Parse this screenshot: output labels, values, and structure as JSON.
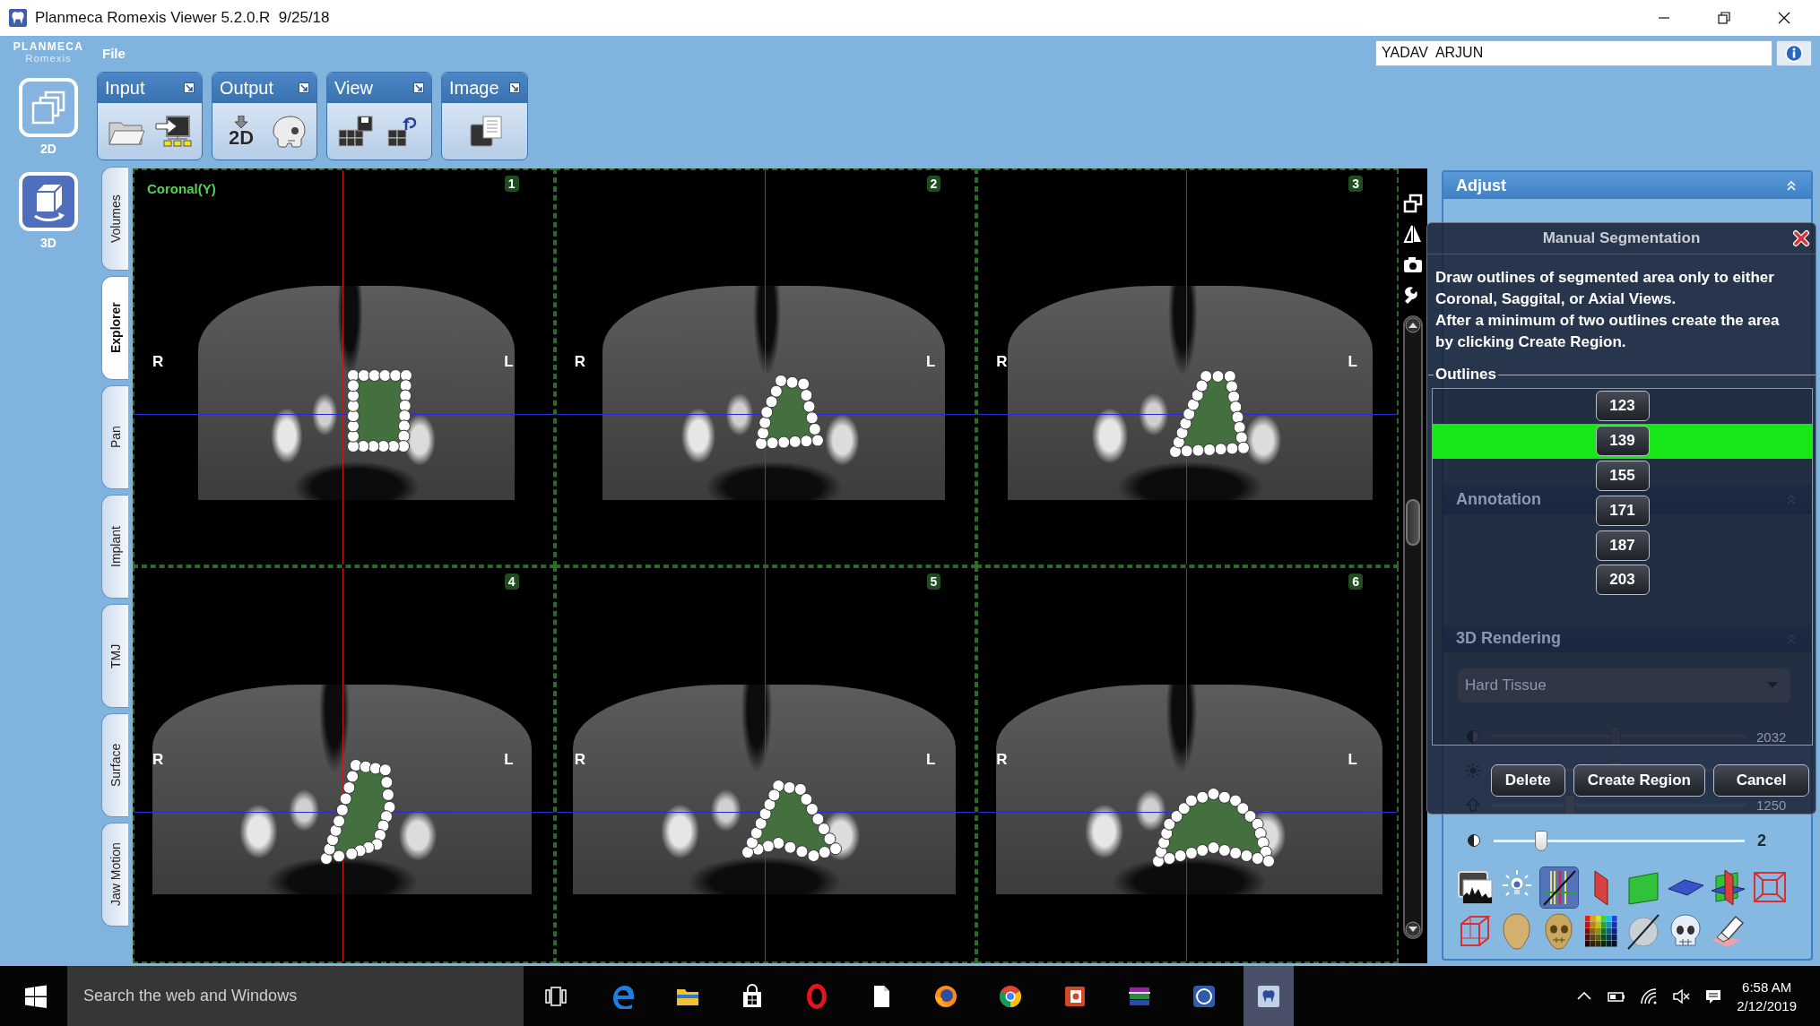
{
  "window": {
    "title": "Planmeca Romexis Viewer 5.2.0.R  9/25/18"
  },
  "logo": {
    "brand": "PLANMECA",
    "product": "Romexis"
  },
  "menu": [
    "File"
  ],
  "patient_field": {
    "value": "YADAV  ARJUN"
  },
  "modes": [
    {
      "label": "2D",
      "selected": false
    },
    {
      "label": "3D",
      "selected": true
    }
  ],
  "toolbar_groups": [
    {
      "title": "Input"
    },
    {
      "title": "Output",
      "button_text": "2D"
    },
    {
      "title": "View"
    },
    {
      "title": "Image"
    }
  ],
  "view_tabs": [
    {
      "label": "Volumes",
      "selected": false
    },
    {
      "label": "Explorer",
      "selected": true
    },
    {
      "label": "Pan",
      "selected": false
    },
    {
      "label": "Implant",
      "selected": false
    },
    {
      "label": "TMJ",
      "selected": false
    },
    {
      "label": "Surface",
      "selected": false
    },
    {
      "label": "Jaw Motion",
      "selected": false
    }
  ],
  "viewer": {
    "panels": [
      {
        "number": "1",
        "view_label": "Coronal(Y)",
        "left_marker": "R",
        "right_marker": "L"
      },
      {
        "number": "2",
        "left_marker": "R",
        "right_marker": "L"
      },
      {
        "number": "3",
        "left_marker": "R",
        "right_marker": "L"
      },
      {
        "number": "4",
        "left_marker": "R",
        "right_marker": "L"
      },
      {
        "number": "5",
        "left_marker": "R",
        "right_marker": "L"
      },
      {
        "number": "6",
        "left_marker": "R",
        "right_marker": "L"
      }
    ]
  },
  "adjust_panel": {
    "title": "Adjust",
    "annotation_section": {
      "title": "Annotation"
    },
    "rendering_section": {
      "title": "3D Rendering",
      "mode": "Hard Tissue",
      "sliders": [
        {
          "level": 0.49,
          "reading": "2032"
        },
        {
          "level": 0.49
        },
        {
          "level": 0.31,
          "reading": "1250"
        }
      ]
    },
    "point_slider": {
      "level": 0.19,
      "reading": "2"
    },
    "render_tools": [
      {
        "selected": false
      },
      {
        "selected": false
      },
      {
        "selected": true
      },
      {
        "selected": false
      },
      {
        "selected": false
      },
      {
        "selected": false
      },
      {
        "selected": false
      },
      {
        "selected": false
      },
      {
        "selected": false
      },
      {
        "selected": false
      },
      {
        "selected": false
      },
      {
        "selected": false
      },
      {
        "selected": false
      },
      {
        "selected": false
      },
      {
        "selected": false
      }
    ]
  },
  "segmentation_dialog": {
    "title": "Manual Segmentation",
    "instructions": [
      "Draw outlines of segmented area only to either Coronal, Saggital, or Axial Views.",
      "After a minimum of two outlines create the area by clicking Create Region."
    ],
    "outlines_label": "Outlines",
    "outlines": [
      {
        "label": "123",
        "selected": false
      },
      {
        "label": "139",
        "selected": true
      },
      {
        "label": "155",
        "selected": false
      },
      {
        "label": "171",
        "selected": false
      },
      {
        "label": "187",
        "selected": false
      },
      {
        "label": "203",
        "selected": false
      }
    ],
    "buttons": [
      "Delete",
      "Create Region",
      "Cancel"
    ]
  },
  "taskbar": {
    "search": {
      "placeholder": "Search the web and Windows"
    },
    "apps": [
      {
        "selected": false
      },
      {
        "selected": false
      },
      {
        "selected": false
      },
      {
        "selected": false
      },
      {
        "selected": false
      },
      {
        "selected": false
      },
      {
        "selected": false
      },
      {
        "selected": false
      },
      {
        "selected": false
      },
      {
        "selected": false
      },
      {
        "selected": true
      }
    ],
    "clock": {
      "time": "6:58 AM",
      "date": "2/12/2019"
    }
  }
}
